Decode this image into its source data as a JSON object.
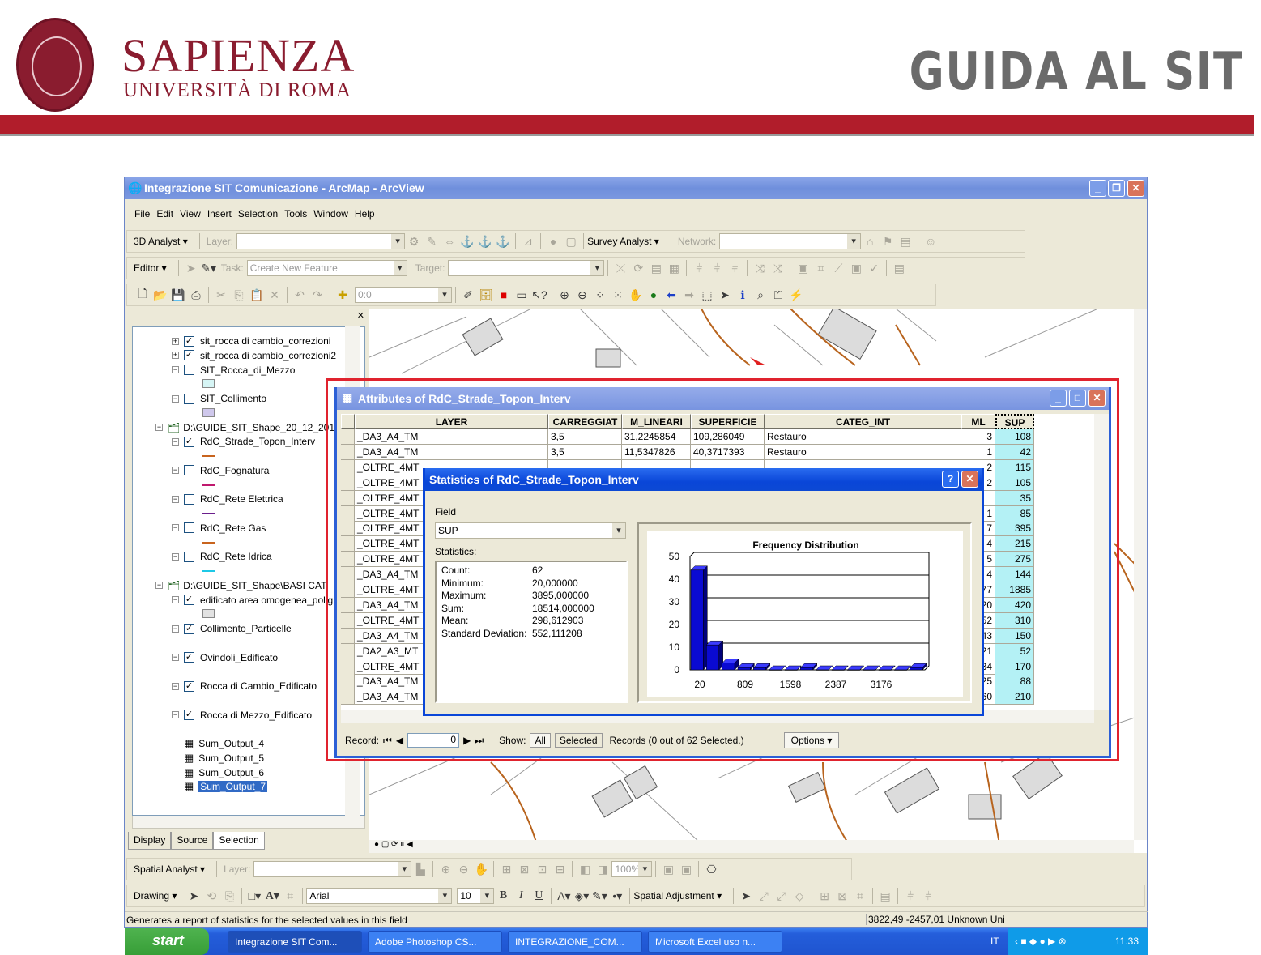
{
  "slide_header": {
    "brand_name": "SAPIENZA",
    "brand_subtitle": "UNIVERSITÀ DI ROMA",
    "seal_text": "STVDIVM VRBIS",
    "doc_title": "GUIDA AL SIT",
    "accent_color": "#b11d2b"
  },
  "app": {
    "title": "Integrazione SIT Comunicazione - ArcMap - ArcView",
    "menu": [
      "File",
      "Edit",
      "View",
      "Insert",
      "Selection",
      "Tools",
      "Window",
      "Help"
    ],
    "toolbar1": {
      "analyst": "3D Analyst ▾",
      "layer_label": "Layer:",
      "survey": "Survey Analyst ▾",
      "network_label": "Network:"
    },
    "toolbar2": {
      "editor": "Editor ▾",
      "task_label": "Task:",
      "task_value": "Create New Feature",
      "target_label": "Target:"
    },
    "toolbar3": {
      "scale_value": "0:0"
    },
    "toc": {
      "tabs": [
        "Display",
        "Source",
        "Selection"
      ],
      "items": [
        {
          "label": "sit_rocca di cambio_correzioni",
          "level": 2,
          "exp": "+",
          "check": true
        },
        {
          "label": "sit_rocca di cambio_correzioni2",
          "level": 2,
          "exp": "+",
          "check": true
        },
        {
          "label": "SIT_Rocca_di_Mezzo",
          "level": 2,
          "exp": "-",
          "check": false,
          "symbol": {
            "type": "fill",
            "color": "#d6f5f5"
          }
        },
        {
          "label": "SIT_Collimento",
          "level": 2,
          "exp": "-",
          "check": false,
          "symbol": {
            "type": "fill",
            "color": "#cfc8ec"
          }
        },
        {
          "label": "D:\\GUIDE_SIT_Shape_20_12_2011",
          "level": 1,
          "exp": "-",
          "group": true
        },
        {
          "label": "RdC_Strade_Topon_Interv",
          "level": 2,
          "exp": "-",
          "check": true,
          "symbol": {
            "type": "line",
            "color": "#c8641e"
          }
        },
        {
          "label": "RdC_Fognatura",
          "level": 2,
          "exp": "-",
          "check": false,
          "symbol": {
            "type": "line",
            "color": "#c0186e"
          }
        },
        {
          "label": "RdC_Rete Elettrica",
          "level": 2,
          "exp": "-",
          "check": false,
          "symbol": {
            "type": "line",
            "color": "#6a1e8c"
          }
        },
        {
          "label": "RdC_Rete Gas",
          "level": 2,
          "exp": "-",
          "check": false,
          "symbol": {
            "type": "line",
            "color": "#c8641e"
          }
        },
        {
          "label": "RdC_Rete Idrica",
          "level": 2,
          "exp": "-",
          "check": false,
          "symbol": {
            "type": "line",
            "color": "#1ec8e6"
          }
        },
        {
          "label": "D:\\GUIDE_SIT_Shape\\BASI CAT",
          "level": 1,
          "exp": "-",
          "group": true
        },
        {
          "label": "edificato area omogenea_polig",
          "level": 2,
          "exp": "-",
          "check": true,
          "symbol": {
            "type": "fill",
            "color": "#e2e2e2"
          }
        },
        {
          "label": "Collimento_Particelle",
          "level": 2,
          "exp": "-",
          "check": true,
          "symbol": {
            "type": "none"
          }
        },
        {
          "label": "Ovindoli_Edificato",
          "level": 2,
          "exp": "-",
          "check": true,
          "symbol": {
            "type": "none"
          }
        },
        {
          "label": "Rocca di Cambio_Edificato",
          "level": 2,
          "exp": "-",
          "check": true,
          "symbol": {
            "type": "none"
          }
        },
        {
          "label": "Rocca di Mezzo_Edificato",
          "level": 2,
          "exp": "-",
          "check": true,
          "symbol": {
            "type": "none"
          }
        },
        {
          "label": "Sum_Output_4",
          "level": 2,
          "table": true
        },
        {
          "label": "Sum_Output_5",
          "level": 2,
          "table": true
        },
        {
          "label": "Sum_Output_6",
          "level": 2,
          "table": true
        },
        {
          "label": "Sum_Output_7",
          "level": 2,
          "table": true,
          "selected": true
        }
      ]
    },
    "attributes": {
      "title": "Attributes of RdC_Strade_Topon_Interv",
      "columns": [
        "LAYER",
        "CARREGGIAT",
        "M_LINEARI",
        "SUPERFICIE",
        "CATEG_INT",
        "ML",
        "SUP"
      ],
      "rows": [
        [
          "_DA3_A4_TM",
          "3,5",
          "31,2245854",
          "109,286049",
          "Restauro",
          "3",
          "108"
        ],
        [
          "_DA3_A4_TM",
          "3,5",
          "11,5347826",
          "40,3717393",
          "Restauro",
          "1",
          "42"
        ],
        [
          "_OLTRE_4MT",
          "",
          "",
          "",
          "",
          "2",
          "115"
        ],
        [
          "_OLTRE_4MT",
          "",
          "",
          "",
          "",
          "2",
          "105"
        ],
        [
          "_OLTRE_4MT",
          "",
          "",
          "",
          "",
          "",
          "35"
        ],
        [
          "_OLTRE_4MT",
          "",
          "",
          "",
          "",
          "1",
          "85"
        ],
        [
          "_OLTRE_4MT",
          "",
          "",
          "",
          "",
          "7",
          "395"
        ],
        [
          "_OLTRE_4MT",
          "",
          "",
          "",
          "",
          "4",
          "215"
        ],
        [
          "_OLTRE_4MT",
          "",
          "",
          "",
          "",
          "5",
          "275"
        ],
        [
          "_DA3_A4_TM",
          "",
          "",
          "",
          "",
          "4",
          "144"
        ],
        [
          "_OLTRE_4MT",
          "",
          "",
          "",
          "",
          "77",
          "1885"
        ],
        [
          "_DA3_A4_TM",
          "",
          "",
          "",
          "",
          "20",
          "420"
        ],
        [
          "_OLTRE_4MT",
          "",
          "",
          "",
          "",
          "52",
          "310"
        ],
        [
          "_DA3_A4_TM",
          "",
          "",
          "",
          "",
          "43",
          "150"
        ],
        [
          "_DA2_A3_MT",
          "",
          "",
          "",
          "",
          "21",
          "52"
        ],
        [
          "_OLTRE_4MT",
          "",
          "",
          "",
          "",
          "34",
          "170"
        ],
        [
          "_DA3_A4_TM",
          "",
          "",
          "",
          "",
          "25",
          "88"
        ],
        [
          "_DA3_A4_TM",
          "",
          "",
          "",
          "",
          "60",
          "210"
        ]
      ],
      "record_label": "Record:",
      "record_value": "0",
      "show_label": "Show:",
      "show_all": "All",
      "show_selected": "Selected",
      "records_status": "Records (0 out of 62 Selected.)",
      "options": "Options ▾"
    },
    "statistics": {
      "title": "Statistics of RdC_Strade_Topon_Interv",
      "field_label": "Field",
      "field_value": "SUP",
      "stats_label": "Statistics:",
      "stats": [
        {
          "k": "Count:",
          "v": "62"
        },
        {
          "k": "Minimum:",
          "v": "20,000000"
        },
        {
          "k": "Maximum:",
          "v": "3895,000000"
        },
        {
          "k": "Sum:",
          "v": "18514,000000"
        },
        {
          "k": "Mean:",
          "v": "298,612903"
        },
        {
          "k": "Standard Deviation:",
          "v": "552,111208"
        }
      ]
    },
    "bottom_toolbar1": {
      "analyst": "Spatial Analyst ▾",
      "layer_label": "Layer:",
      "zoom": "100%"
    },
    "bottom_toolbar2": {
      "drawing": "Drawing ▾",
      "font": "Arial",
      "size": "10",
      "bold": "B",
      "italic": "I",
      "underline": "U",
      "adjust": "Spatial Adjustment ▾"
    },
    "status": {
      "message": "Generates a report of statistics for the selected values in this field",
      "coords": "3822,49  -2457,01 Unknown Uni"
    },
    "taskbar": {
      "start": "start",
      "tasks": [
        "Integrazione SIT Com...",
        "Adobe Photoshop CS...",
        "INTEGRAZIONE_COM...",
        "Microsoft Excel uso n..."
      ],
      "lang": "IT",
      "time": "11.33"
    }
  },
  "chart_data": {
    "type": "bar",
    "title": "Frequency Distribution",
    "x_tick_labels": [
      "20",
      "809",
      "1598",
      "2387",
      "3176"
    ],
    "y_ticks": [
      0,
      10,
      20,
      30,
      40,
      50
    ],
    "ylim": [
      0,
      50
    ],
    "xlim": [
      20,
      3895
    ],
    "values": [
      44,
      11,
      3,
      1,
      1,
      0,
      0,
      1,
      0,
      0,
      0,
      0,
      0,
      0,
      1
    ],
    "bar_color": "#0a0ad2",
    "grid": true
  }
}
